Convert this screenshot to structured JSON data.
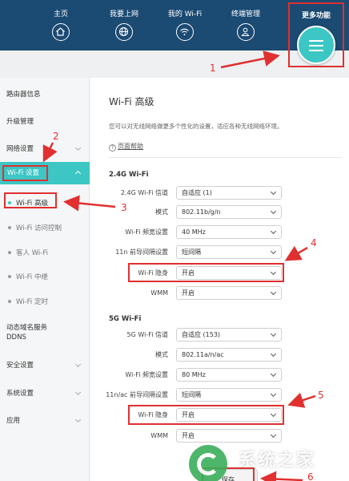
{
  "nav": {
    "items": [
      {
        "label": "主页",
        "icon": "home-icon"
      },
      {
        "label": "我要上网",
        "icon": "globe-icon"
      },
      {
        "label": "我的 Wi-Fi",
        "icon": "wifi-icon"
      },
      {
        "label": "终端管理",
        "icon": "user-icon"
      }
    ],
    "more_label": "更多功能",
    "more_icon": "menu-icon"
  },
  "sidebar": {
    "router_info": "路由器信息",
    "upgrade": "升级管理",
    "network": "网络设置",
    "wifi": "Wi-Fi 设置",
    "wifi_sub": [
      "Wi-Fi 高级",
      "Wi-Fi 访问控制",
      "客人 Wi-Fi",
      "Wi-Fi 中继",
      "Wi-Fi 定时"
    ],
    "ddns_line1": "动态域名服务",
    "ddns_line2": "DDNS",
    "security": "安全设置",
    "system": "系统设置",
    "apps": "应用"
  },
  "main": {
    "title": "Wi-Fi 高级",
    "description": "您可以对无线网络做更多个性化的设置，适应各种无线网络环境。",
    "help": "页面帮助",
    "help_icon": "?"
  },
  "wifi24": {
    "title": "2.4G Wi-Fi",
    "channel_label": "2.4G Wi-Fi 信道",
    "channel_value": "自适应 (1)",
    "mode_label": "模式",
    "mode_value": "802.11b/g/n",
    "bandwidth_label": "Wi-Fi 频宽设置",
    "bandwidth_value": "40 MHz",
    "preamble_label": "11n 前导间隔设置",
    "preamble_value": "短间隔",
    "hidden_label": "Wi-Fi 隐身",
    "hidden_value": "开启",
    "wmm_label": "WMM",
    "wmm_value": "开启"
  },
  "wifi5": {
    "title": "5G Wi-Fi",
    "channel_label": "5G Wi-Fi 信道",
    "channel_value": "自适应 (153)",
    "mode_label": "模式",
    "mode_value": "802.11a/n/ac",
    "bandwidth_label": "Wi-Fi 频宽设置",
    "bandwidth_value": "80 MHz",
    "preamble_label": "11n/ac 前导间隔设置",
    "preamble_value": "短间隔",
    "hidden_label": "Wi-Fi 隐身",
    "hidden_value": "开启",
    "wmm_label": "WMM",
    "wmm_value": "开启"
  },
  "save_label": "保存",
  "annotations": [
    "1",
    "2",
    "3",
    "4",
    "5",
    "6"
  ],
  "watermark": "系统之家",
  "colors": {
    "nav_bg": "#1b4a73",
    "accent": "#3cc6c4",
    "annotation_red": "#e03030"
  }
}
